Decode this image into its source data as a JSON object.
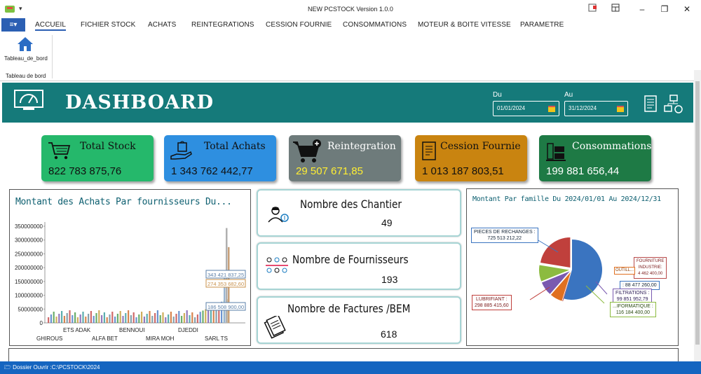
{
  "window": {
    "title": "NEW PCSTOCK Version 1.0.0"
  },
  "menu": {
    "file_glyph": "≡▾",
    "items": [
      "ACCUEIL",
      "FICHIER STOCK",
      "ACHATS",
      "REINTEGRATIONS",
      "CESSION FOURNIE",
      "CONSOMMATIONS",
      "MOTEUR & BOITE VITESSE",
      "PARAMETRE"
    ]
  },
  "ribbon": {
    "button_label": "Tableau_de_bord",
    "group_label": "Tableau de bord"
  },
  "dashboard": {
    "title": "DASHBOARD",
    "date_from_label": "Du",
    "date_from": "01/01/2024",
    "date_to_label": "Au",
    "date_to": "31/12/2024"
  },
  "cards": [
    {
      "title": "Total Stock",
      "value": "822 783 875,76",
      "color": "#25b86b",
      "value_color": "#111"
    },
    {
      "title": "Total Achats",
      "value": "1 343 762 442,77",
      "color": "#2e8fe0",
      "value_color": "#111"
    },
    {
      "title": "Reintegration",
      "value": "29 507 671,85",
      "color": "#6e7b7b",
      "value_color": "#ffee33"
    },
    {
      "title": "Cession Fournie",
      "value": "1 013 187 803,51",
      "color": "#c98410",
      "value_color": "#111"
    },
    {
      "title": "Consommations",
      "value": "199 881 656,44",
      "color": "#1e7a45",
      "value_color": "#fff"
    }
  ],
  "achats_chart": {
    "title": "Montant des Achats Par fournisseurs Du...",
    "y_ticks": [
      "350000000",
      "300000000",
      "250000000",
      "200000000",
      "150000000",
      "100000000",
      "50000000",
      "0"
    ],
    "x_labels_row1": [
      "ETS ADAK",
      "BENNOUI",
      "DJEDDI"
    ],
    "x_labels_row2": [
      "GHIROUS",
      "ALFA BET",
      "MIRA MOH",
      "SARL TS"
    ],
    "value_labels": [
      "343 421 837,25",
      "274 353 682,60",
      "186 508 900,00"
    ]
  },
  "stats": [
    {
      "title": "Nombre des Chantier",
      "value": "49"
    },
    {
      "title": "Nombre de Fournisseurs",
      "value": "193"
    },
    {
      "title": "Nombre de Factures /BEM",
      "value": "618"
    }
  ],
  "famille_chart": {
    "title": "Montant Par famille Du 2024/01/01 Au 2024/12/31",
    "slices": [
      {
        "label": "PIECES DE RECHANGES",
        "value": 725513212.22,
        "display": "PIECES DE RECHANGES :\n725 513 212,22",
        "color": "#3a74c0"
      },
      {
        "label": "LUBRIFIANT",
        "value": 298885415.6,
        "display": "LUBRIFIANT :\n298 885 415,60",
        "color": "#c0403c"
      },
      {
        "label": "FOURNITURE INDUSTRIE",
        "value": 4462400.0,
        "display": "FOURNITURE\nINDUSTRIE:\n4 462 400,00",
        "color": "#b84a4a"
      },
      {
        "label": "OUTILLAGE",
        "value": 88477260.0,
        "display": "OUTILL...",
        "color": "#e07020"
      },
      {
        "label": "FILTRATIONS",
        "value": 99851952.79,
        "display": "FILTRATIONS :\n99 851 952,79",
        "color": "#7a5ab0"
      },
      {
        "label": "INFORMATIQUE",
        "value": 116184400.0,
        "display": "...IFORMATIQUE :\n116 184 400,00",
        "color": "#8cbb40"
      }
    ],
    "extra_labels": [
      ": 88 477 260,00"
    ]
  },
  "status": {
    "text": "Dossier Ouvrir :C:\\PCSTOCK\\2024"
  }
}
